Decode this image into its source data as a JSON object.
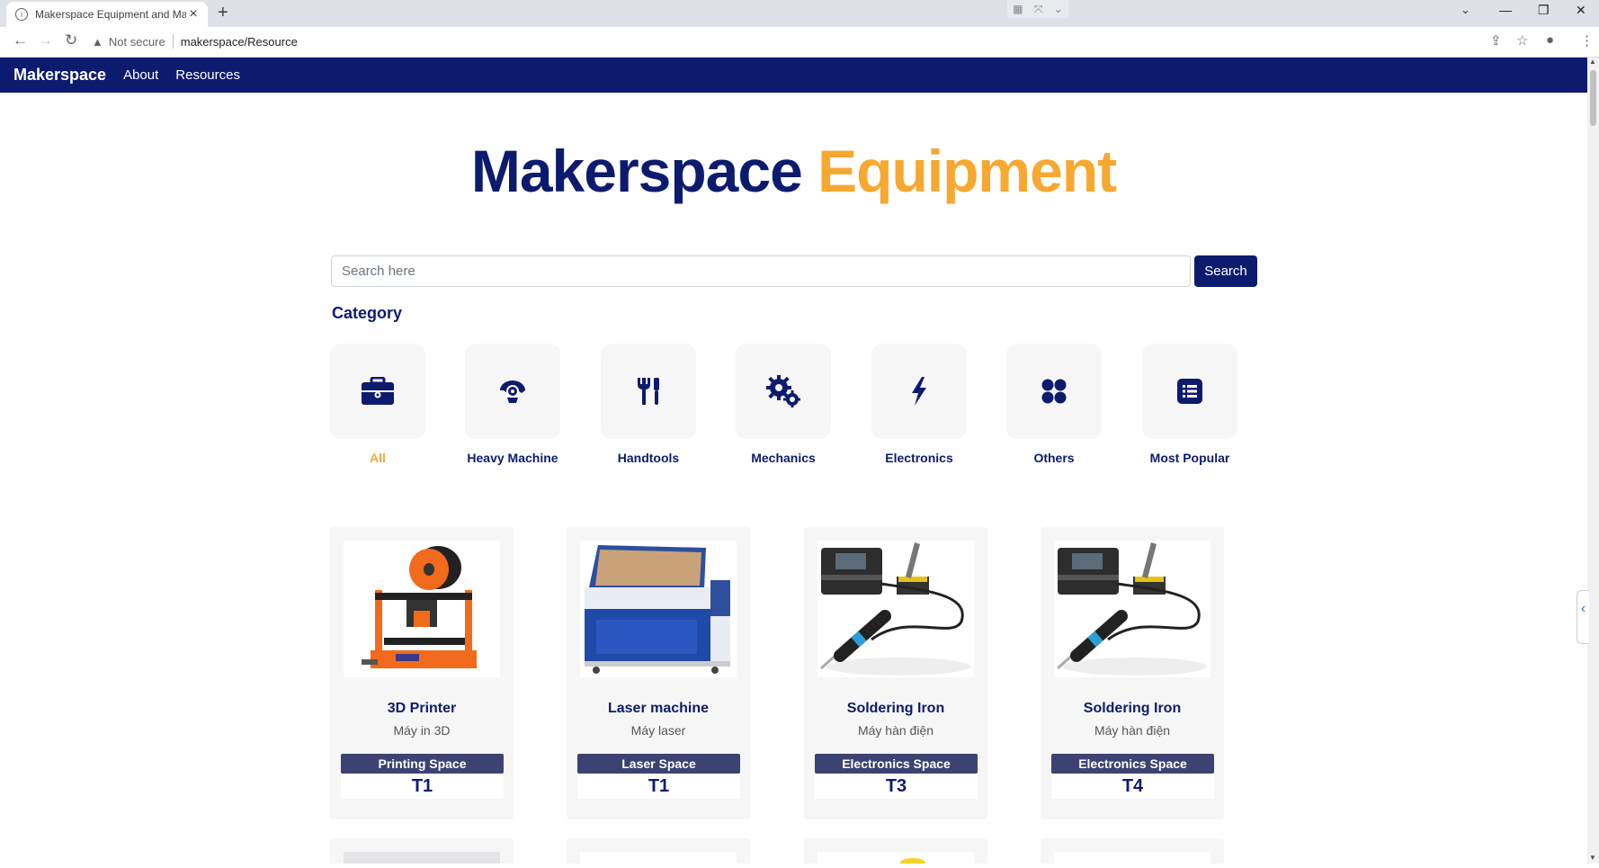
{
  "browser": {
    "tab_title": "Makerspace Equipment and Mat",
    "not_secure": "Not secure",
    "url": "makerspace/Resource"
  },
  "nav": {
    "brand": "Makerspace",
    "links": [
      "About",
      "Resources"
    ]
  },
  "hero": {
    "title_main": "Makerspace",
    "title_accent": "Equipment"
  },
  "search": {
    "placeholder": "Search here",
    "button": "Search"
  },
  "category": {
    "heading": "Category",
    "items": [
      {
        "label": "All",
        "icon": "toolbox-icon",
        "active": true
      },
      {
        "label": "Heavy Machine",
        "icon": "saw-icon"
      },
      {
        "label": "Handtools",
        "icon": "tools-icon"
      },
      {
        "label": "Mechanics",
        "icon": "gears-icon"
      },
      {
        "label": "Electronics",
        "icon": "bolt-icon"
      },
      {
        "label": "Others",
        "icon": "dots-icon"
      },
      {
        "label": "Most Popular",
        "icon": "list-icon"
      }
    ]
  },
  "equipment": [
    {
      "name": "3D Printer",
      "sub": "Máy in 3D",
      "space": "Printing Space",
      "code": "T1",
      "image": "3d-printer"
    },
    {
      "name": "Laser machine",
      "sub": "Máy laser",
      "space": "Laser Space",
      "code": "T1",
      "image": "laser-machine"
    },
    {
      "name": "Soldering Iron",
      "sub": "Máy hàn điện",
      "space": "Electronics Space",
      "code": "T3",
      "image": "soldering-iron"
    },
    {
      "name": "Soldering Iron",
      "sub": "Máy hàn điện",
      "space": "Electronics Space",
      "code": "T4",
      "image": "soldering-iron"
    }
  ],
  "colors": {
    "navy": "#0d1b6e",
    "accent": "#f6a830",
    "badge": "#3c4373"
  }
}
